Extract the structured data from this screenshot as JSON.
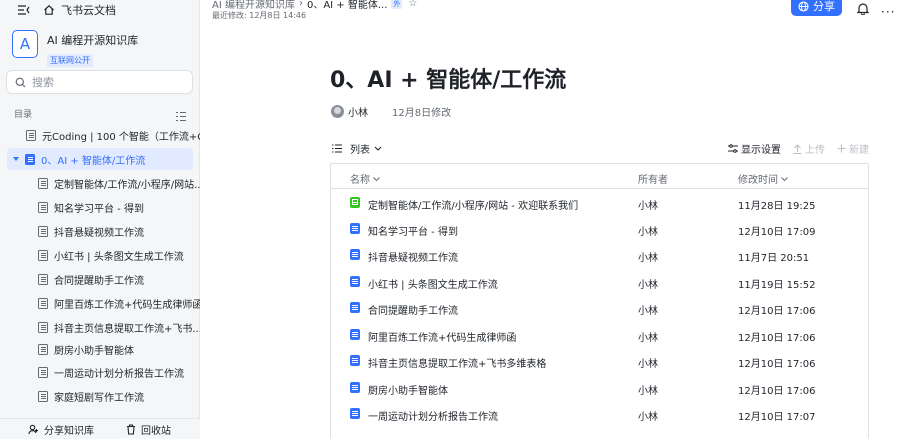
{
  "sidebar": {
    "crumb": "飞书云文档",
    "kb_logo_letter": "A",
    "kb_title": "AI 编程开源知识库",
    "kb_badge": "互联网公开",
    "search_placeholder": "搜索",
    "toc_label": "目录",
    "tree": [
      {
        "label": "元Coding | 100 个智能（工作流+C...",
        "active": false
      },
      {
        "label": "0、AI + 智能体/工作流",
        "active": true
      },
      {
        "label": "定制智能体/工作流/小程序/网站...",
        "active": false
      },
      {
        "label": "知名学习平台 - 得到",
        "active": false
      },
      {
        "label": "抖音悬疑视频工作流",
        "active": false
      },
      {
        "label": "小红书 | 头条图文生成工作流",
        "active": false
      },
      {
        "label": "合同提醒助手工作流",
        "active": false
      },
      {
        "label": "阿里百炼工作流+代码生成律师函",
        "active": false
      },
      {
        "label": "抖音主页信息提取工作流+飞书...",
        "active": false
      },
      {
        "label": "厨房小助手智能体",
        "active": false
      },
      {
        "label": "一周运动计划分析报告工作流",
        "active": false
      },
      {
        "label": "家庭短剧写作工作流",
        "active": false
      }
    ],
    "bottom": {
      "share": "分享知识库",
      "trash": "回收站"
    }
  },
  "topbar": {
    "path_parent": "AI 编程开源知识库",
    "path_current": "0、AI + 智能体...",
    "path_tag": "外",
    "last_modified": "最近修改: 12月8日 14:46",
    "share_label": "分享"
  },
  "doc": {
    "title": "0、AI + 智能体/工作流",
    "author": "小林",
    "modified": "12月8日修改"
  },
  "toolbar": {
    "view": "列表",
    "settings": "显示设置",
    "upload": "上传",
    "new": "新建"
  },
  "table": {
    "headers": {
      "name": "名称",
      "owner": "所有者",
      "modified": "修改时间"
    },
    "rows": [
      {
        "type": "sheet",
        "name": "定制智能体/工作流/小程序/网站 - 欢迎联系我们",
        "owner": "小林",
        "time": "11月28日 19:25"
      },
      {
        "type": "doc",
        "name": "知名学习平台 - 得到",
        "owner": "小林",
        "time": "12月10日 17:09"
      },
      {
        "type": "doc",
        "name": "抖音悬疑视频工作流",
        "owner": "小林",
        "time": "11月7日 20:51"
      },
      {
        "type": "doc",
        "name": "小红书 | 头条图文生成工作流",
        "owner": "小林",
        "time": "11月19日 15:52"
      },
      {
        "type": "doc",
        "name": "合同提醒助手工作流",
        "owner": "小林",
        "time": "12月10日 17:06"
      },
      {
        "type": "doc",
        "name": "阿里百炼工作流+代码生成律师函",
        "owner": "小林",
        "time": "12月10日 17:06"
      },
      {
        "type": "doc",
        "name": "抖音主页信息提取工作流+飞书多维表格",
        "owner": "小林",
        "time": "12月10日 17:06"
      },
      {
        "type": "doc",
        "name": "厨房小助手智能体",
        "owner": "小林",
        "time": "12月10日 17:06"
      },
      {
        "type": "doc",
        "name": "一周运动计划分析报告工作流",
        "owner": "小林",
        "time": "12月10日 17:07"
      }
    ]
  },
  "colors": {
    "accent": "#3370ff",
    "sheet": "#34c724",
    "sidebar_bg": "#f5f6f7"
  }
}
